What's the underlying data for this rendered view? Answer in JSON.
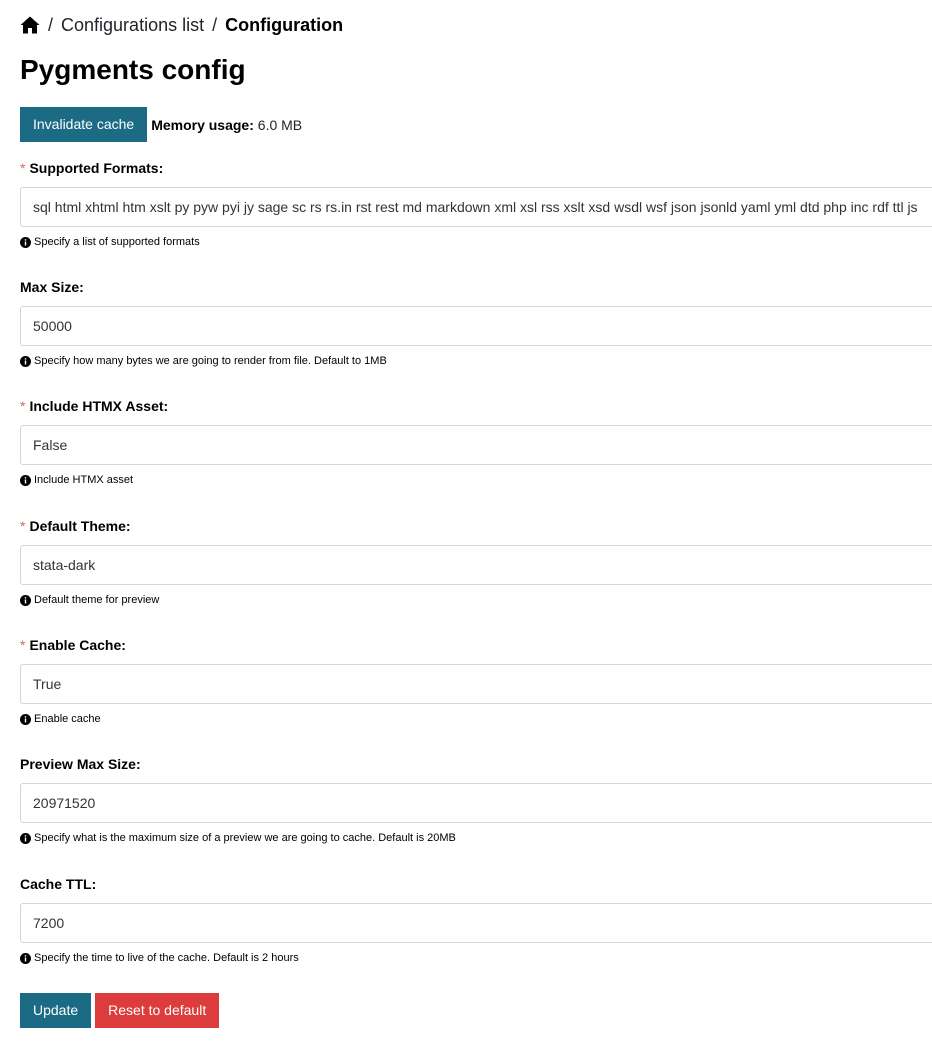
{
  "breadcrumb": {
    "home_icon": "home-icon",
    "separator": "/",
    "items": [
      {
        "label": "Configurations list"
      },
      {
        "label": "Configuration"
      }
    ]
  },
  "page": {
    "title": "Pygments config"
  },
  "toolbar": {
    "invalidate_label": "Invalidate cache",
    "memory_label": "Memory usage:",
    "memory_value": "6.0 MB"
  },
  "fields": [
    {
      "label": "Supported Formats:",
      "required": true,
      "value": "sql html xhtml htm xslt py pyw pyi jy sage sc rs rs.in rst rest md markdown xml xsl rss xslt xsd wsdl wsf json jsonld yaml yml dtd php inc rdf ttl js",
      "help": "Specify a list of supported formats"
    },
    {
      "label": "Max Size:",
      "required": false,
      "value": "50000",
      "help": "Specify how many bytes we are going to render from file. Default to 1MB"
    },
    {
      "label": "Include HTMX Asset:",
      "required": true,
      "value": "False",
      "help": "Include HTMX asset"
    },
    {
      "label": "Default Theme:",
      "required": true,
      "value": "stata-dark",
      "help": "Default theme for preview"
    },
    {
      "label": "Enable Cache:",
      "required": true,
      "value": "True",
      "help": "Enable cache"
    },
    {
      "label": "Preview Max Size:",
      "required": false,
      "value": "20971520",
      "help": "Specify what is the maximum size of a preview we are going to cache. Default is 20MB"
    },
    {
      "label": "Cache TTL:",
      "required": false,
      "value": "7200",
      "help": "Specify the time to live of the cache. Default is 2 hours"
    }
  ],
  "required_marker": "*",
  "actions": {
    "update_label": "Update",
    "reset_label": "Reset to default"
  },
  "colors": {
    "primary": "#1c6b84",
    "danger": "#dc3c3c",
    "required_star": "#e06060"
  }
}
